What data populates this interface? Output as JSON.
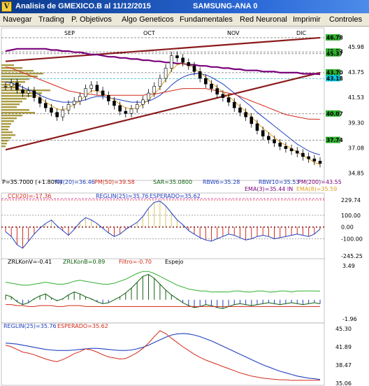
{
  "window": {
    "title": "Analisis de GMEXICO.B al 11/12/2015",
    "device": "SAMSUNG-ANA 0",
    "icon": "chart-app-icon"
  },
  "menu": [
    "Navegar",
    "Trading",
    "P. Objetivos",
    "Algo Geneticos",
    "Fundamentales",
    "Red Neuronal",
    "Imprimir",
    "Controles"
  ],
  "colors": {
    "price_line": "#000000",
    "resistance_line": "#8b1a1a",
    "pm200": "#7a007a",
    "pm50": "#d12a1a",
    "pm20": "#2040c0",
    "ema8": "#e0a020",
    "level_cyan": "#00a8c0",
    "volume_profile": "#9a8a20",
    "cci": "#2040c0",
    "zrl_green": "#30b030",
    "zrl_dark": "#106010",
    "esperado": "#d12a1a"
  },
  "chart_data": [
    {
      "type": "line",
      "title": "",
      "months": [
        "SEP",
        "OCT",
        "NOV",
        "DIC"
      ],
      "ylim": [
        34.2,
        46.9
      ],
      "y_ticks": [
        "45.98",
        "43.75",
        "41.53",
        "39.30",
        "37.08",
        "34.85"
      ],
      "level_tags": [
        {
          "label": "46.78",
          "value": 46.78,
          "color": "#30b030"
        },
        {
          "label": "45.53",
          "value": 45.53,
          "color": "#30b030"
        },
        {
          "label": "45.37",
          "value": 45.37,
          "color": "#30b030"
        },
        {
          "label": "43.70",
          "value": 43.7,
          "color": "#30b030"
        },
        {
          "label": "43.18",
          "value": 43.18,
          "color": "#00c8e0"
        },
        {
          "label": "40.07",
          "value": 40.07,
          "color": "#30b030"
        },
        {
          "label": "37.74",
          "value": 37.74,
          "color": "#30b030"
        }
      ],
      "series": [
        {
          "name": "P",
          "values": [
            42.5,
            42.8,
            42.2,
            41.9,
            42.1,
            41.5,
            41.0,
            40.6,
            40.2,
            39.8,
            40.4,
            40.9,
            41.2,
            41.6,
            42.3,
            42.6,
            42.1,
            41.7,
            41.2,
            40.8,
            40.3,
            40.1,
            40.5,
            40.9,
            41.3,
            41.9,
            42.5,
            43.2,
            44.1,
            45.2,
            45.0,
            44.6,
            44.3,
            43.8,
            43.2,
            42.7,
            42.3,
            41.8,
            41.5,
            41.1,
            40.6,
            40.2,
            39.8,
            39.2,
            38.6,
            38.1,
            37.8,
            37.5,
            37.2,
            37.0,
            36.8,
            36.6,
            36.3,
            36.1,
            35.9,
            35.7
          ]
        },
        {
          "name": "PM(20)",
          "values": [
            42.9,
            42.8,
            42.6,
            42.4,
            42.2,
            42.0,
            41.7,
            41.5,
            41.3,
            41.2,
            41.1,
            41.1,
            41.1,
            41.2,
            41.3,
            41.5,
            41.6,
            41.6,
            41.5,
            41.4,
            41.3,
            41.2,
            41.1,
            41.1,
            41.1,
            41.2,
            41.4,
            41.7,
            42.1,
            42.6,
            43.0,
            43.3,
            43.5,
            43.6,
            43.6,
            43.5,
            43.3,
            43.0,
            42.7,
            42.3,
            41.9,
            41.5,
            41.1,
            40.7,
            40.2,
            39.8,
            39.4,
            39.0,
            38.6,
            38.2,
            37.8,
            37.4,
            37.1,
            36.8,
            36.6,
            36.46
          ]
        },
        {
          "name": "PM(50)",
          "values": [
            44.2,
            44.1,
            43.9,
            43.7,
            43.5,
            43.3,
            43.1,
            42.9,
            42.7,
            42.5,
            42.3,
            42.1,
            42.0,
            41.9,
            41.8,
            41.8,
            41.7,
            41.7,
            41.7,
            41.7,
            41.7,
            41.7,
            41.7,
            41.7,
            41.7,
            41.8,
            41.8,
            41.9,
            42.0,
            42.1,
            42.2,
            42.3,
            42.3,
            42.3,
            42.3,
            42.3,
            42.2,
            42.1,
            42.0,
            41.9,
            41.8,
            41.6,
            41.4,
            41.2,
            41.0,
            40.8,
            40.6,
            40.4,
            40.2,
            40.0,
            39.9,
            39.8,
            39.7,
            39.6,
            39.6,
            39.58
          ]
        },
        {
          "name": "PM(200)",
          "values": [
            45.6,
            45.7,
            45.8,
            45.8,
            45.8,
            45.8,
            45.8,
            45.8,
            45.7,
            45.7,
            45.6,
            45.6,
            45.5,
            45.5,
            45.4,
            45.3,
            45.3,
            45.2,
            45.1,
            45.1,
            45.0,
            45.0,
            44.9,
            44.9,
            44.8,
            44.8,
            44.7,
            44.7,
            44.6,
            44.6,
            44.5,
            44.5,
            44.4,
            44.4,
            44.3,
            44.3,
            44.2,
            44.2,
            44.1,
            44.1,
            44.0,
            44.0,
            43.9,
            43.9,
            43.9,
            43.8,
            43.8,
            43.8,
            43.7,
            43.7,
            43.7,
            43.7,
            43.6,
            43.6,
            43.6,
            43.55
          ]
        },
        {
          "name": "EMA(8)",
          "values": [
            42.7,
            42.6,
            42.4,
            42.1,
            42.0,
            41.8,
            41.5,
            41.1,
            40.8,
            40.5,
            40.4,
            40.6,
            40.9,
            41.2,
            41.7,
            42.1,
            42.1,
            41.9,
            41.6,
            41.3,
            40.9,
            40.6,
            40.5,
            40.6,
            40.9,
            41.3,
            41.8,
            42.4,
            43.1,
            43.9,
            44.4,
            44.5,
            44.4,
            44.1,
            43.7,
            43.3,
            42.8,
            42.4,
            42.0,
            41.6,
            41.2,
            40.7,
            40.3,
            39.8,
            39.3,
            38.8,
            38.4,
            38.0,
            37.6,
            37.3,
            37.0,
            36.7,
            36.4,
            36.1,
            35.8,
            35.59
          ]
        }
      ],
      "trendlines": [
        {
          "name": "resistance-upper",
          "from": [
            0,
            44.7
          ],
          "to": [
            55,
            46.78
          ]
        },
        {
          "name": "support-rising",
          "from": [
            0,
            36.9
          ],
          "to": [
            55,
            43.7
          ]
        }
      ]
    },
    {
      "type": "line",
      "title": "",
      "ylim": [
        -245.25,
        229.74
      ],
      "y_ticks": [
        "229.74",
        "100.00",
        "0.00",
        "-100.00",
        "-245.25"
      ],
      "series": [
        {
          "name": "CCI(20)",
          "values": [
            -40,
            -80,
            -150,
            -180,
            -120,
            -60,
            -10,
            30,
            60,
            10,
            -30,
            -70,
            -20,
            40,
            80,
            60,
            30,
            -10,
            -50,
            -80,
            -60,
            -20,
            10,
            40,
            90,
            160,
            210,
            220,
            180,
            120,
            60,
            20,
            -30,
            -60,
            -90,
            -110,
            -120,
            -100,
            -80,
            -60,
            -70,
            -90,
            -110,
            -100,
            -80,
            -70,
            -80,
            -100,
            -90,
            -80,
            -70,
            -60,
            -70,
            -80,
            -60,
            -17.36
          ]
        }
      ],
      "labels": {
        "cci": "CCI(20)=-17.36",
        "reglin": "REGLIN(25)=35.76",
        "esperado": "ESPERADO=35.62"
      }
    },
    {
      "type": "line",
      "title": "",
      "ylim": [
        -1.96,
        3.49
      ],
      "y_ticks": [
        "3.49",
        "-1.96"
      ],
      "series": [
        {
          "name": "ZRLKonV",
          "values": [
            0.5,
            0.3,
            -0.2,
            -0.5,
            -0.3,
            0.1,
            0.4,
            0.6,
            0.2,
            -0.1,
            0.1,
            0.5,
            0.8,
            0.6,
            0.3,
            0.1,
            -0.2,
            -0.4,
            -0.3,
            0.0,
            0.3,
            0.7,
            1.2,
            1.8,
            2.4,
            2.6,
            2.2,
            1.6,
            1.0,
            0.5,
            0.1,
            -0.3,
            -0.6,
            -0.8,
            -0.7,
            -0.5,
            -0.6,
            -0.8,
            -0.9,
            -0.7,
            -0.5,
            -0.4,
            -0.5,
            -0.6,
            -0.5,
            -0.4,
            -0.3,
            -0.4,
            -0.5,
            -0.4,
            -0.3,
            -0.4,
            -0.5,
            -0.4,
            -0.3,
            -0.41
          ]
        },
        {
          "name": "ZRLKonB",
          "values": [
            1.8,
            1.7,
            1.6,
            1.5,
            1.5,
            1.6,
            1.7,
            1.8,
            1.7,
            1.6,
            1.6,
            1.7,
            1.9,
            2.0,
            1.9,
            1.8,
            1.7,
            1.6,
            1.6,
            1.7,
            1.9,
            2.1,
            2.4,
            2.7,
            2.9,
            2.9,
            2.7,
            2.4,
            2.1,
            1.8,
            1.5,
            1.3,
            1.1,
            1.0,
            0.9,
            0.9,
            0.8,
            0.8,
            0.8,
            0.8,
            0.9,
            0.9,
            0.8,
            0.8,
            0.9,
            0.9,
            0.8,
            0.8,
            0.9,
            0.9,
            0.8,
            0.9,
            0.9,
            0.9,
            0.9,
            0.89
          ]
        },
        {
          "name": "Filtro",
          "values": [
            -0.5,
            -0.5,
            -0.6,
            -0.6,
            -0.7,
            -0.7,
            -0.6,
            -0.6,
            -0.6,
            -0.7,
            -0.7,
            -0.6,
            -0.6,
            -0.6,
            -0.7,
            -0.7,
            -0.7,
            -0.7,
            -0.7,
            -0.7,
            -0.7,
            -0.7,
            -0.7,
            -0.7,
            -0.7,
            -0.7,
            -0.7,
            -0.7,
            -0.7,
            -0.7,
            -0.7,
            -0.7,
            -0.7,
            -0.7,
            -0.7,
            -0.7,
            -0.7,
            -0.7,
            -0.7,
            -0.7,
            -0.7,
            -0.7,
            -0.7,
            -0.7,
            -0.7,
            -0.7,
            -0.7,
            -0.7,
            -0.7,
            -0.7,
            -0.7,
            -0.7,
            -0.7,
            -0.7,
            -0.7,
            -0.7
          ]
        }
      ],
      "labels": {
        "zrlkonv": "ZRLKonV=-0.41",
        "zrlkonb": "ZRLKonB=0.89",
        "filtro": "Filtro=-0.70",
        "espejo": "Espejo"
      }
    },
    {
      "type": "line",
      "title": "",
      "ylim": [
        35.06,
        45.3
      ],
      "y_ticks": [
        "45.30",
        "41.89",
        "38.47",
        "35.06"
      ],
      "series": [
        {
          "name": "REGLIN(25)",
          "values": [
            42.6,
            42.5,
            42.4,
            42.2,
            42.0,
            41.8,
            41.6,
            41.4,
            41.3,
            41.2,
            41.2,
            41.2,
            41.3,
            41.4,
            41.5,
            41.6,
            41.6,
            41.5,
            41.4,
            41.3,
            41.2,
            41.2,
            41.3,
            41.5,
            41.8,
            42.2,
            42.7,
            43.2,
            43.7,
            44.1,
            44.3,
            44.4,
            44.3,
            44.1,
            43.8,
            43.4,
            43.0,
            42.5,
            42.0,
            41.5,
            41.0,
            40.5,
            40.0,
            39.5,
            39.0,
            38.5,
            38.1,
            37.7,
            37.3,
            37.0,
            36.7,
            36.4,
            36.2,
            36.0,
            35.9,
            35.76
          ]
        },
        {
          "name": "ESPERADO",
          "values": [
            42.2,
            41.9,
            41.4,
            40.9,
            40.7,
            40.4,
            40.0,
            39.6,
            39.3,
            39.1,
            39.5,
            40.0,
            40.6,
            41.0,
            41.5,
            41.3,
            40.9,
            40.4,
            40.0,
            39.8,
            39.6,
            39.7,
            40.2,
            40.8,
            41.6,
            42.6,
            43.8,
            44.9,
            44.4,
            43.5,
            42.7,
            41.9,
            41.2,
            40.5,
            39.9,
            39.4,
            39.0,
            38.6,
            38.2,
            37.8,
            37.4,
            37.0,
            36.7,
            36.4,
            36.2,
            36.0,
            35.9,
            35.8,
            35.7,
            35.7,
            35.6,
            35.6,
            35.6,
            35.6,
            35.6,
            35.62
          ]
        }
      ],
      "labels": {
        "reglin": "REGLIN(25)=35.76",
        "esperado": "ESPERADO=35.62"
      }
    }
  ],
  "readouts": {
    "p": "P=35.7000 (+1.80%)",
    "pm20": "PM(20)=36.46",
    "pm50": "PM(50)=39.58",
    "sar": "SAR=35.0800",
    "rbw6": "RBW6=35.28",
    "rbw10": "RBW10=35.53",
    "pm200": "PM(200)=43.55",
    "ema3": "EMA(3)=35.44 IN",
    "ema8": "EMA(8)=35.59"
  }
}
